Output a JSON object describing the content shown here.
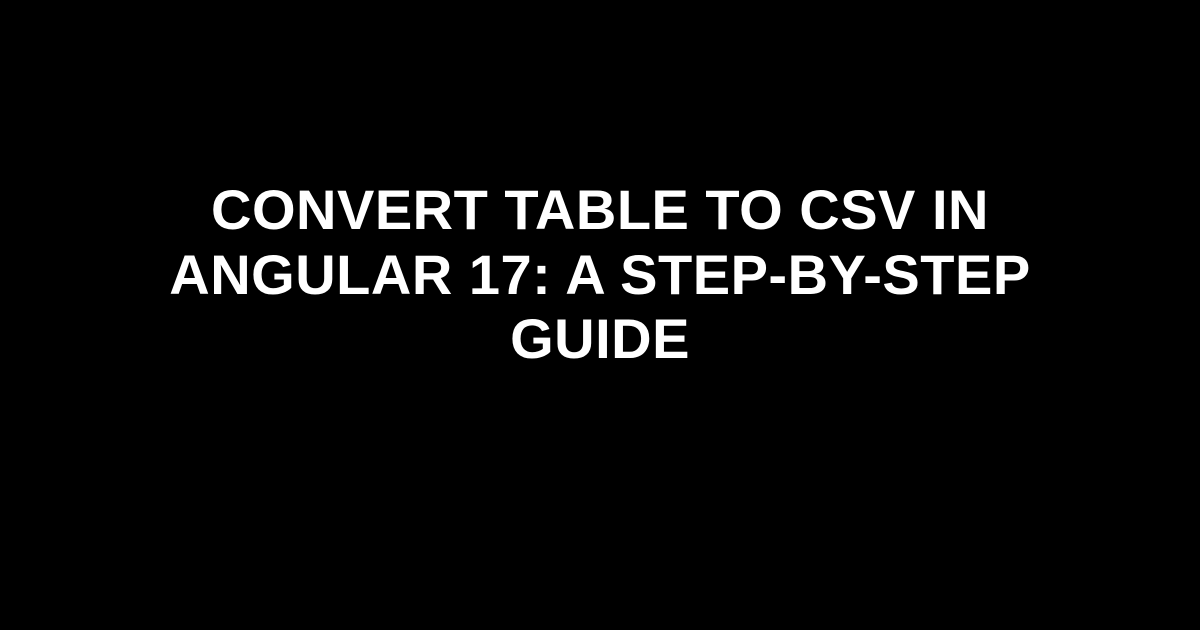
{
  "title": "Convert Table to CSV in Angular 17: A Step-by-Step Guide"
}
